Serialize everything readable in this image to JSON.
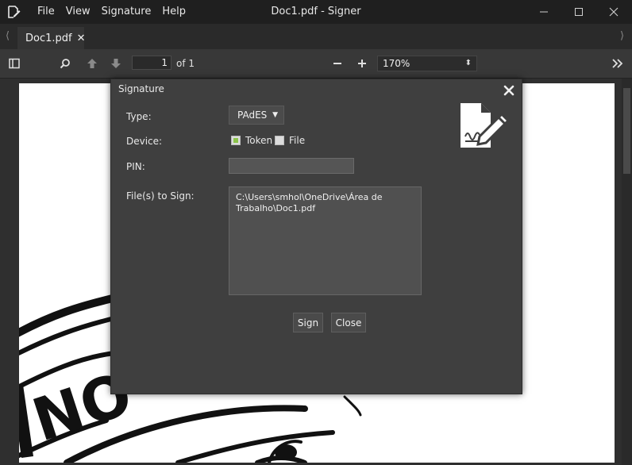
{
  "window": {
    "title": "Doc1.pdf - Signer",
    "menu": [
      "File",
      "View",
      "Signature",
      "Help"
    ],
    "controls": [
      "minimize-icon",
      "maximize-icon",
      "close-icon"
    ]
  },
  "tabs": [
    {
      "label": "Doc1.pdf",
      "close": "✕",
      "active": true
    }
  ],
  "toolbar": {
    "page_current": "1",
    "page_of": "of 1",
    "zoom": "170%",
    "icons": [
      "sidebar-toggle-icon",
      "search-icon",
      "page-up-icon",
      "page-down-icon",
      "zoom-out-icon",
      "zoom-in-icon",
      "more-tools-icon"
    ]
  },
  "dialog": {
    "title": "Signature",
    "type_label": "Type:",
    "type_value": "PAdES",
    "device_label": "Device:",
    "device_options": [
      {
        "label": "Token",
        "checked": true
      },
      {
        "label": "File",
        "checked": false
      }
    ],
    "pin_label": "PIN:",
    "pin_value": "",
    "files_label": "File(s) to Sign:",
    "files_value": "C:\\Users\\smhol\\OneDrive\\Área de Trabalho\\Doc1.pdf",
    "sign_button": "Sign",
    "close_button": "Close",
    "accent_color": "#8bc34a"
  },
  "document": {
    "visible_text": "NO"
  }
}
